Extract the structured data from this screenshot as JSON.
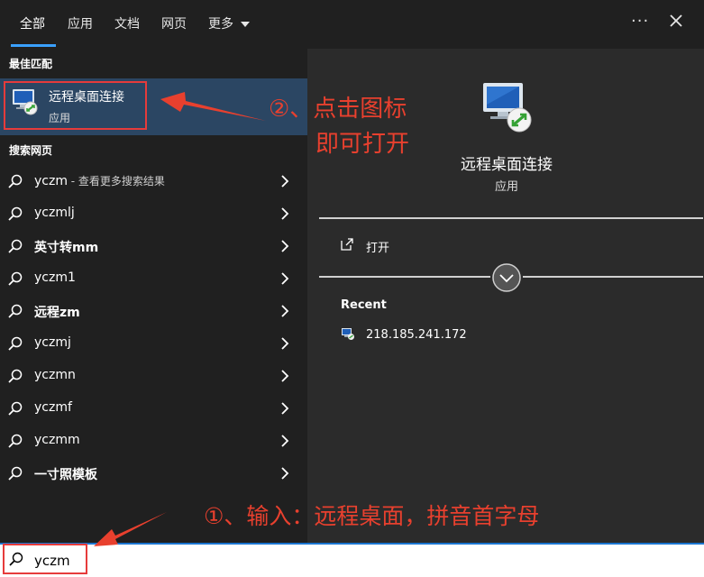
{
  "tabs": [
    {
      "label": "全部",
      "active": true
    },
    {
      "label": "应用"
    },
    {
      "label": "文档"
    },
    {
      "label": "网页"
    },
    {
      "label": "更多"
    }
  ],
  "toolbar": {
    "more_dots": "···"
  },
  "left": {
    "best_match_heading": "最佳匹配",
    "best_match": {
      "title": "远程桌面连接",
      "subtitle": "应用"
    },
    "web_search_heading": "搜索网页",
    "results": [
      {
        "text": "yczm",
        "hint": " - 查看更多搜索结果"
      },
      {
        "text": "yczmlj"
      },
      {
        "text": "英寸转mm"
      },
      {
        "text": "yczm1"
      },
      {
        "text": "远程zm"
      },
      {
        "text": "yczmj"
      },
      {
        "text": "yczmn"
      },
      {
        "text": "yczmf"
      },
      {
        "text": "yczmm"
      },
      {
        "text": "一寸照模板"
      }
    ]
  },
  "search": {
    "value": "yczm"
  },
  "preview": {
    "title": "远程桌面连接",
    "subtitle": "应用",
    "open_label": "打开",
    "recent_heading": "Recent",
    "recent_items": [
      "218.185.241.172"
    ]
  },
  "annotations": {
    "step2_line1": "②、点击图标",
    "step2_line2": "即可打开",
    "step1": "①、输入：远程桌面，拼音首字母"
  },
  "colors": {
    "accent": "#3aa0ff",
    "highlight": "#2b4663",
    "annotation": "#e8402e"
  }
}
